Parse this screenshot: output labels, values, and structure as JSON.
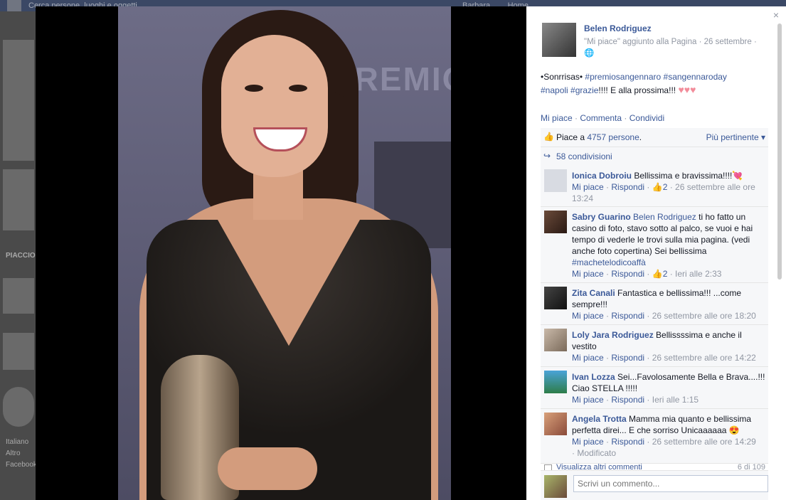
{
  "background": {
    "search_placeholder": "Cerca persone, luoghi e oggetti",
    "right_user": "Barbara",
    "right_link": "Home",
    "left_label": "PIACCIONO",
    "left_footer": [
      "Italiano",
      "Altro",
      "Facebook"
    ]
  },
  "post": {
    "author": "Belen Rodriguez",
    "meta": "\"Mi piace\" aggiunto alla Pagina · 26 settembre ·",
    "text_prefix": "•Sonrrisas• ",
    "tags": [
      "#premiosangennaro",
      "#sangennaroday",
      "#napoli",
      "#grazie"
    ],
    "text_suffix": "!!!! E alla prossima!!! ",
    "hearts": "♥♥♥",
    "actions": [
      "Mi piace",
      "Commenta",
      "Condividi"
    ]
  },
  "feedback": {
    "likes_prefix": "Piace a ",
    "likes_count": "4757 persone",
    "likes_suffix": ".",
    "sort_label": "Più pertinente ▾",
    "shares": "58 condivisioni"
  },
  "comments": [
    {
      "name": "Ionica Dobroiu",
      "mention": "",
      "text": "Bellissima e bravissima!!!!💘",
      "like": "Mi piace",
      "reply": "Rispondi",
      "likes": "2",
      "time": "26 settembre alle ore 13:24",
      "extra": ""
    },
    {
      "name": "Sabry Guarino",
      "mention": "Belen Rodriguez",
      "text": "ti ho fatto un casino di foto, stavo sotto al palco, se vuoi e hai tempo di vederle le trovi sulla mia pagina. (vedi anche foto copertina) Sei bellissima ",
      "hashtag": "#machetelodicoaffà",
      "like": "Mi piace",
      "reply": "Rispondi",
      "likes": "2",
      "time": "Ieri alle 2:33",
      "extra": ""
    },
    {
      "name": "Zita Canali",
      "mention": "",
      "text": "Fantastica e bellissima!!! ...come sempre!!!",
      "like": "Mi piace",
      "reply": "Rispondi",
      "likes": "",
      "time": "26 settembre alle ore 18:20",
      "extra": ""
    },
    {
      "name": "Loly Jara Rodriguez",
      "mention": "",
      "text": "Bellissssima e anche il vestito",
      "like": "Mi piace",
      "reply": "Rispondi",
      "likes": "",
      "time": "26 settembre alle ore 14:22",
      "extra": ""
    },
    {
      "name": "Ivan Lozza",
      "mention": "",
      "text": "Sei...Favolosamente Bella e Brava....!!! Ciao STELLA !!!!!",
      "like": "Mi piace",
      "reply": "Rispondi",
      "likes": "",
      "time": "Ieri alle 1:15",
      "extra": ""
    },
    {
      "name": "Angela Trotta",
      "mention": "",
      "text": "Mamma mia quanto e bellissima perfetta direi... E che sorriso Unicaaaaaa 😍",
      "like": "Mi piace",
      "reply": "Rispondi",
      "likes": "",
      "time": "26 settembre alle ore 14:29",
      "extra": "Modificato"
    }
  ],
  "more_comments": {
    "label": "Visualizza altri commenti",
    "count": "6 di 109"
  },
  "compose": {
    "placeholder": "Scrivi un commento..."
  },
  "close": "×",
  "photo_backdrop_text": "PREMIO"
}
